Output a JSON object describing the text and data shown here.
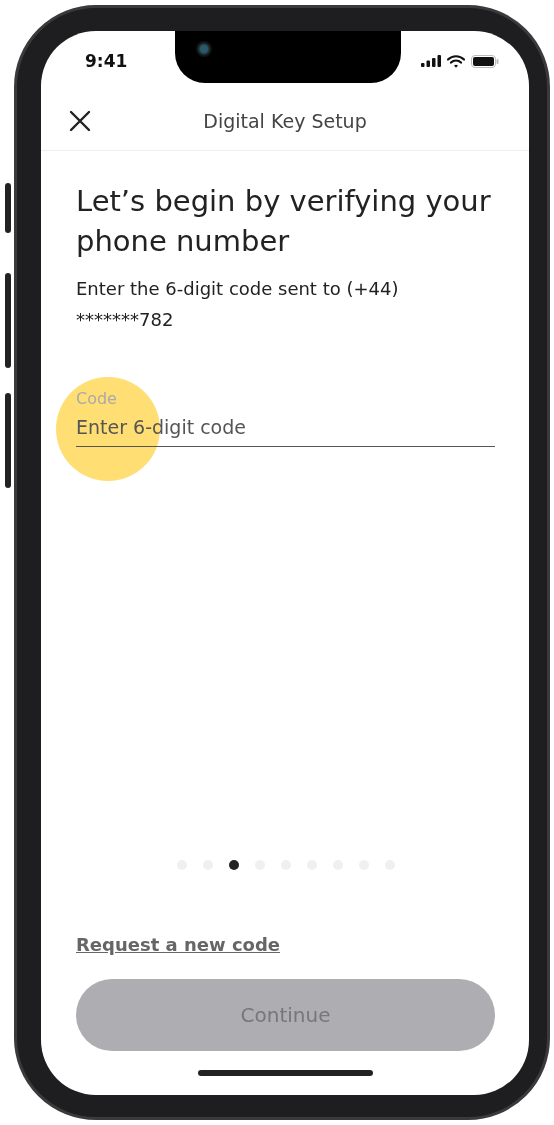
{
  "status_bar": {
    "time": "9:41"
  },
  "header": {
    "title": "Digital Key Setup"
  },
  "heading": "Let’s begin by verifying your phone number",
  "instructions": "Enter the 6-digit code sent to (+44) *******782",
  "code_field": {
    "label": "Code",
    "placeholder": "Enter 6-digit code"
  },
  "pager": [
    {
      "selected": false
    },
    {
      "selected": false
    },
    {
      "selected": true
    },
    {
      "selected": false
    },
    {
      "selected": false
    },
    {
      "selected": false
    },
    {
      "selected": false
    },
    {
      "selected": false
    },
    {
      "selected": false
    }
  ],
  "request_link": "Request a new code",
  "continue_button": {
    "label": "Continue",
    "disabled": true
  }
}
